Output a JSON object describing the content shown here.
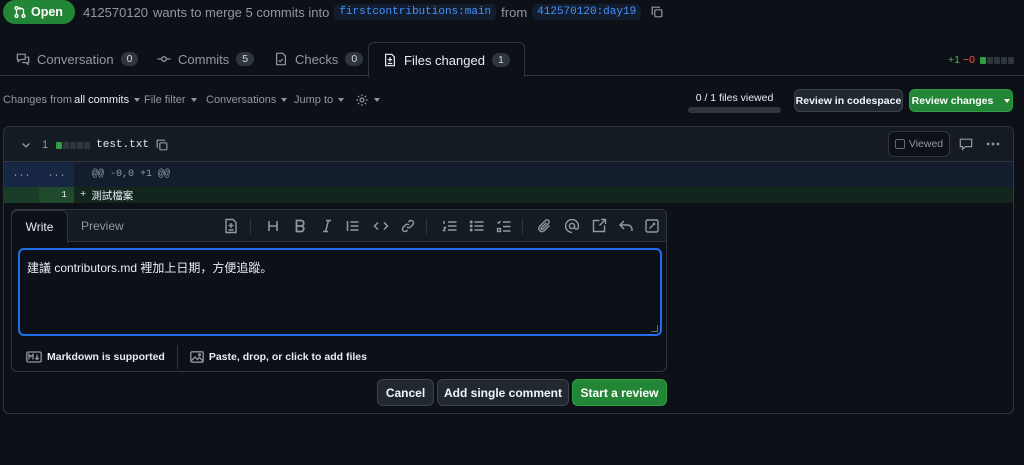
{
  "pr": {
    "state": "Open",
    "author": "412570120",
    "summary_mid": "wants to merge 5 commits into",
    "base_branch": "firstcontributions:main",
    "from_word": "from",
    "head_branch": "412570120:day19"
  },
  "tabs": [
    {
      "label": "Conversation",
      "count": "0"
    },
    {
      "label": "Commits",
      "count": "5"
    },
    {
      "label": "Checks",
      "count": "0"
    },
    {
      "label": "Files changed",
      "count": "1"
    }
  ],
  "diffstat": {
    "additions": "+1",
    "deletions": "−0",
    "blocks": [
      1,
      0,
      0,
      0,
      0
    ]
  },
  "toolbar": {
    "changes_from_prefix": "Changes from",
    "changes_from_value": "all commits",
    "file_filter": "File filter",
    "conversations": "Conversations",
    "jump_to": "Jump to",
    "files_viewed": "0 / 1 files viewed",
    "viewed_fraction": 0,
    "review_in_codespace": "Review in codespace",
    "review_changes": "Review changes"
  },
  "file": {
    "changed_lines": "1",
    "name": "test.txt",
    "viewed_label": "Viewed",
    "hunk_left": "...",
    "hunk_right": "...",
    "hunk_header": "@@ -0,0 +1 @@",
    "added_line_number": "1",
    "added_line_marker": "+",
    "added_line_text": "測試檔案"
  },
  "comment": {
    "tab_write": "Write",
    "tab_preview": "Preview",
    "text": "建議 contributors.md 裡加上日期，方便追蹤。",
    "markdown_note": "Markdown is supported",
    "attach_note": "Paste, drop, or click to add files",
    "cancel": "Cancel",
    "add_single": "Add single comment",
    "start_review": "Start a review"
  },
  "colors": {
    "accent_green": "#238636",
    "focus_blue": "#1f6feb",
    "branch_blue": "#4493f8"
  }
}
